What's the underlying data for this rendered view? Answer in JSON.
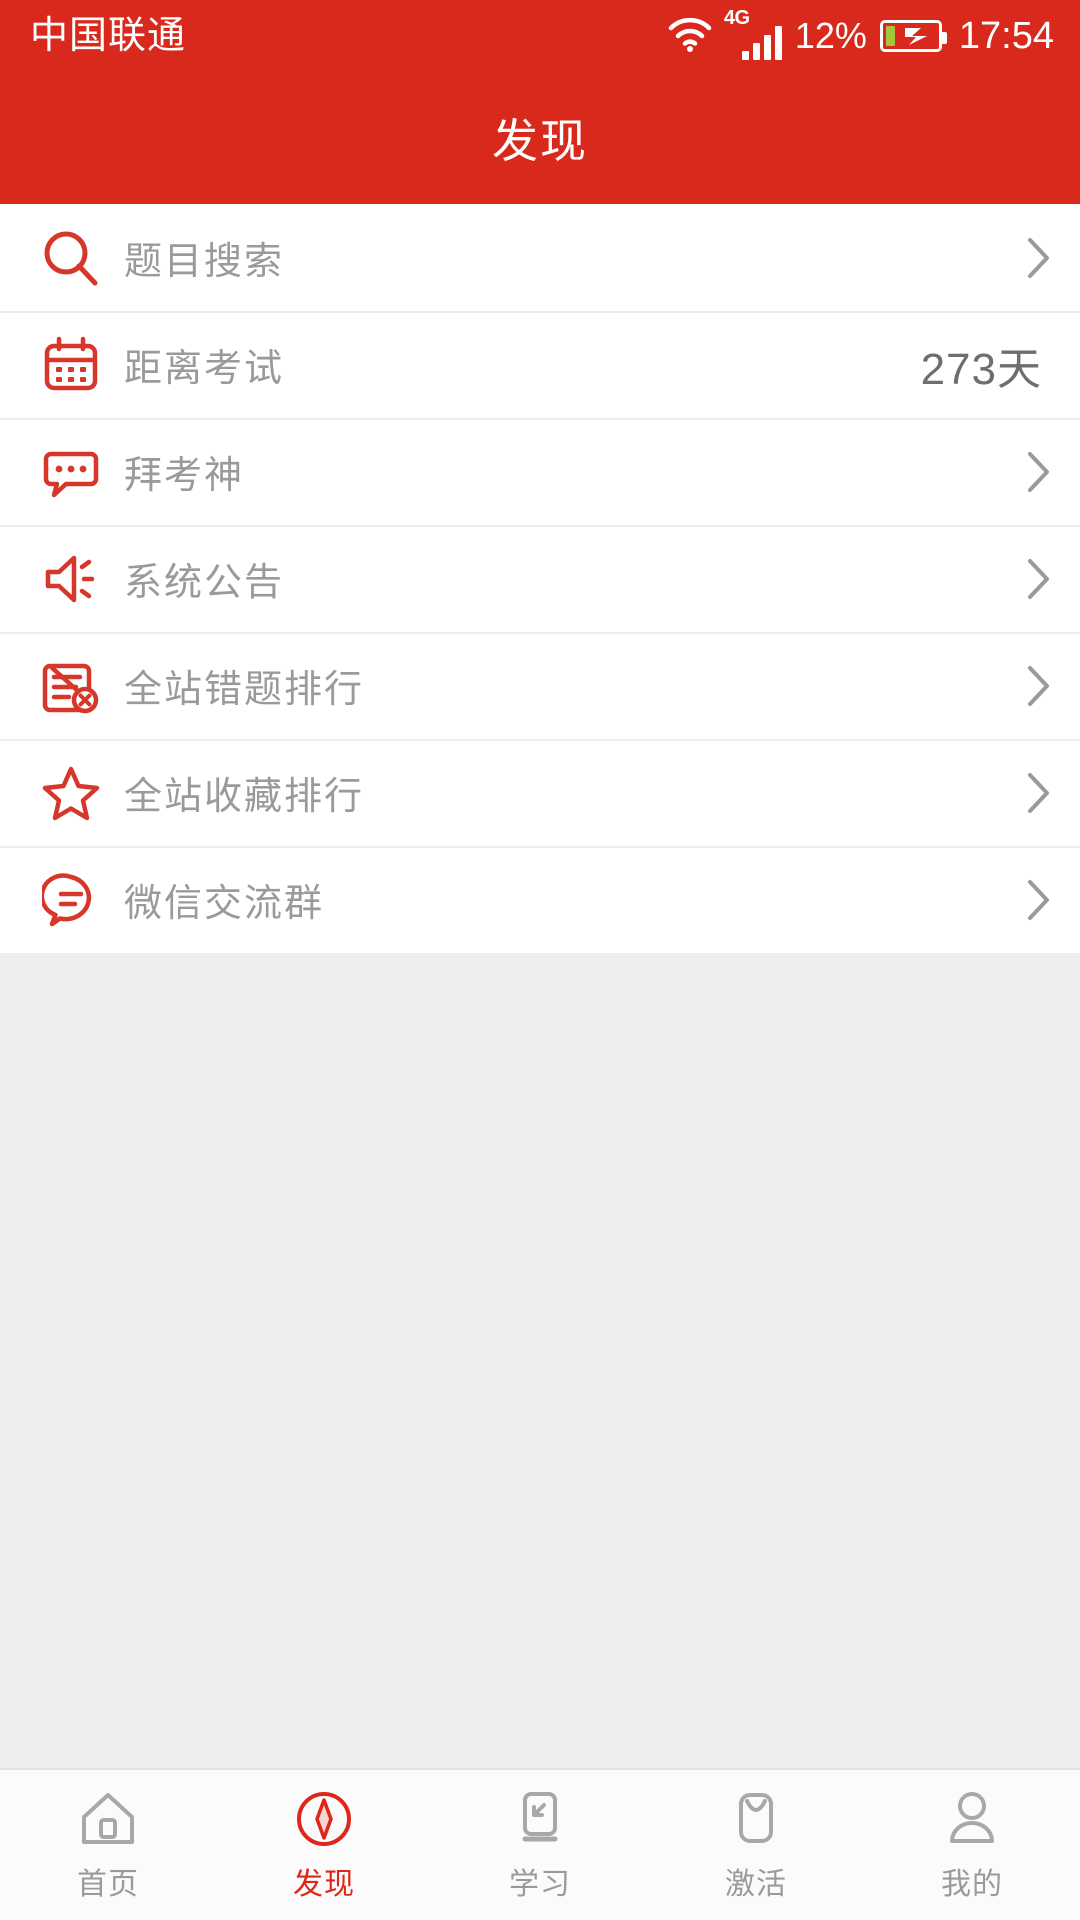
{
  "statusbar": {
    "carrier": "中国联通",
    "network_type": "4G",
    "battery_percent": "12%",
    "clock": "17:54",
    "icons": [
      "wifi-icon",
      "signal-icon",
      "battery-charging-icon"
    ]
  },
  "header": {
    "title": "发现",
    "background_color": "#d9291c"
  },
  "colors": {
    "brand_red": "#d9291c",
    "icon_red": "#d7362a",
    "label_gray": "#9a9a9a",
    "value_gray": "#6e6e6e",
    "page_bg": "#eceef0"
  },
  "list": {
    "rows": [
      {
        "icon": "search-icon",
        "label": "题目搜索",
        "value": "",
        "chevron": true
      },
      {
        "icon": "calendar-icon",
        "label": "距离考试",
        "value": "273天",
        "chevron": false
      },
      {
        "icon": "chat-dots-icon",
        "label": "拜考神",
        "value": "",
        "chevron": true
      },
      {
        "icon": "megaphone-icon",
        "label": "系统公告",
        "value": "",
        "chevron": true
      },
      {
        "icon": "document-error-icon",
        "label": "全站错题排行",
        "value": "",
        "chevron": true
      },
      {
        "icon": "star-icon",
        "label": "全站收藏排行",
        "value": "",
        "chevron": true
      },
      {
        "icon": "wechat-bubble-icon",
        "label": "微信交流群",
        "value": "",
        "chevron": true
      }
    ]
  },
  "tabbar": {
    "items": [
      {
        "icon": "home-icon",
        "label": "首页",
        "active": false
      },
      {
        "icon": "compass-icon",
        "label": "发现",
        "active": true
      },
      {
        "icon": "study-icon",
        "label": "学习",
        "active": false
      },
      {
        "icon": "activate-icon",
        "label": "激活",
        "active": false
      },
      {
        "icon": "person-icon",
        "label": "我的",
        "active": false
      }
    ]
  }
}
